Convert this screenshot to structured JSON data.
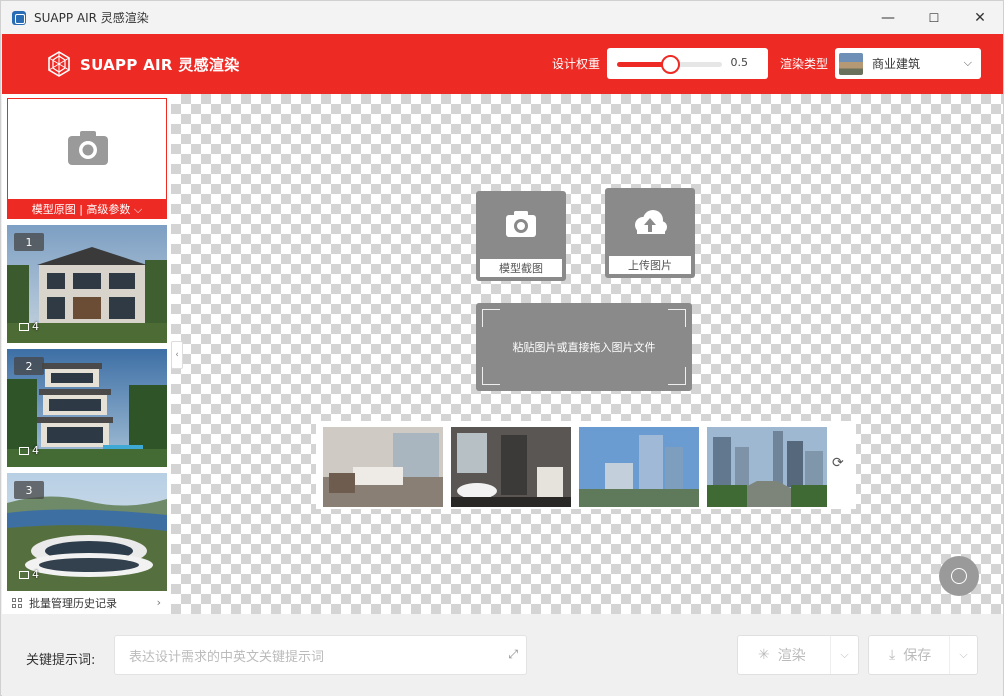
{
  "window": {
    "title": "SUAPP AIR 灵感渲染",
    "minimize": "—",
    "maximize": "☐",
    "close": "✕"
  },
  "header": {
    "brand": "SUAPP AIR 灵感渲染",
    "weight_label": "设计权重",
    "weight_value": "0.5",
    "weight_fraction": 0.5,
    "type_label": "渲染类型",
    "type_value": "商业建筑",
    "accent_color": "#ee2a24"
  },
  "sidebar": {
    "source_label": "模型原图 | 高级参数 ⌵",
    "history_label": "批量管理历史记录",
    "items": [
      {
        "number": "1",
        "count": "4"
      },
      {
        "number": "2",
        "count": "4"
      },
      {
        "number": "3",
        "count": "4"
      }
    ]
  },
  "canvas": {
    "screenshot_label": "模型截图",
    "upload_label": "上传图片",
    "drop_text": "粘贴图片或直接拖入图片文件"
  },
  "bottom": {
    "prompt_label": "关键提示词:",
    "prompt_placeholder": "表达设计需求的中英文关键提示词",
    "render_label": "渲染",
    "save_label": "保存"
  }
}
